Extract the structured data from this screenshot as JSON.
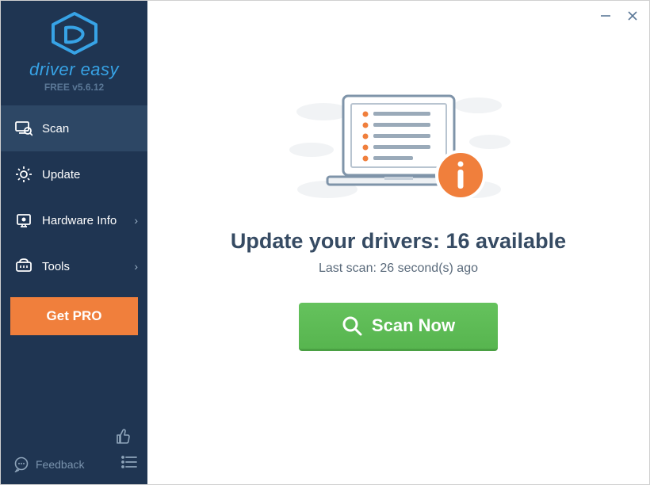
{
  "brand": "driver easy",
  "version": "FREE v5.6.12",
  "nav": {
    "scan": "Scan",
    "update": "Update",
    "hardware": "Hardware Info",
    "tools": "Tools"
  },
  "get_pro": "Get PRO",
  "feedback": "Feedback",
  "main": {
    "headline": "Update your drivers: 16 available",
    "subline": "Last scan: 26 second(s) ago",
    "scan_button": "Scan Now"
  }
}
